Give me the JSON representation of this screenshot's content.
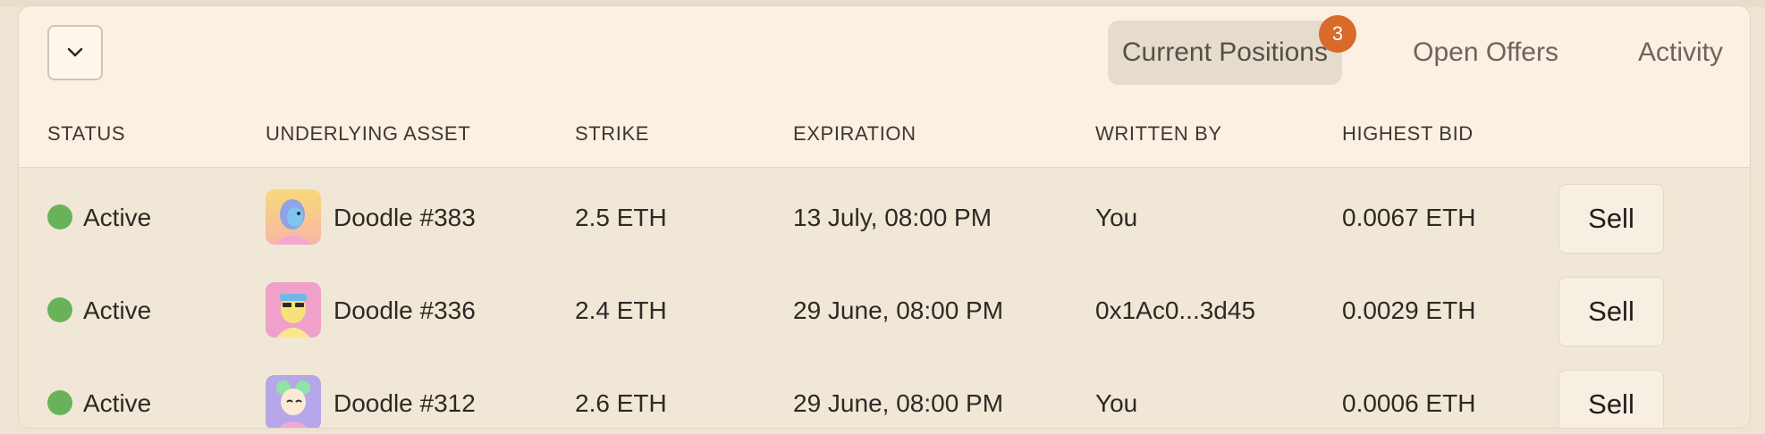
{
  "tabs": {
    "current_positions": "Current Positions",
    "current_positions_count": "3",
    "open_offers": "Open Offers",
    "activity": "Activity"
  },
  "table": {
    "headers": [
      "STATUS",
      "UNDERLYING ASSET",
      "STRIKE",
      "EXPIRATION",
      "WRITTEN BY",
      "HIGHEST BID"
    ],
    "rows": [
      {
        "status": "Active",
        "asset": "Doodle #383",
        "strike": "2.5 ETH",
        "expiration": "13 July, 08:00 PM",
        "written_by": "You",
        "highest_bid": "0.0067 ETH",
        "action": "Sell"
      },
      {
        "status": "Active",
        "asset": "Doodle #336",
        "strike": "2.4 ETH",
        "expiration": "29 June, 08:00 PM",
        "written_by": "0x1Ac0...3d45",
        "highest_bid": "0.0029 ETH",
        "action": "Sell"
      },
      {
        "status": "Active",
        "asset": "Doodle #312",
        "strike": "2.6 ETH",
        "expiration": "29 June, 08:00 PM",
        "written_by": "You",
        "highest_bid": "0.0006 ETH",
        "action": "Sell"
      }
    ]
  },
  "colors": {
    "accent_badge": "#d86a2a",
    "status_active": "#6ab25a"
  },
  "icons": {
    "collapse": "chevron-down-icon",
    "avatars": [
      "doodle-383-avatar",
      "doodle-336-avatar",
      "doodle-312-avatar"
    ]
  }
}
